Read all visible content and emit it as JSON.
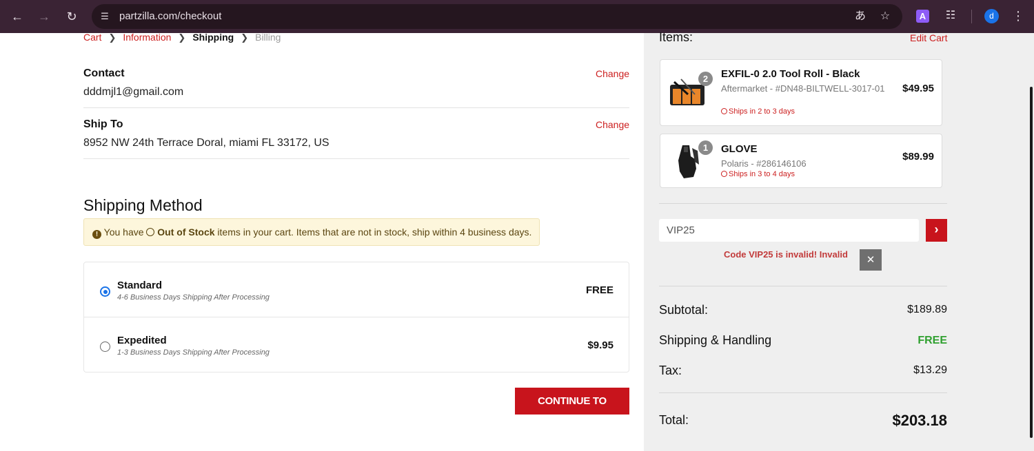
{
  "browser": {
    "url": "partzilla.com/checkout",
    "profile_initial": "d",
    "extension_letter": "A"
  },
  "breadcrumb": {
    "items": [
      "Cart",
      "Information",
      "Shipping",
      "Billing"
    ],
    "current": "Shipping"
  },
  "contact": {
    "label": "Contact",
    "value": "dddmjl1@gmail.com",
    "change": "Change"
  },
  "ship_to": {
    "label": "Ship To",
    "value": "8952 NW 24th Terrace Doral, miami FL 33172, US",
    "change": "Change"
  },
  "shipping_method": {
    "title": "Shipping Method",
    "notice": {
      "prefix": "You have",
      "strong": "Out of Stock",
      "suffix": "items in your cart. Items that are not in stock, ship within 4 business days."
    },
    "options": [
      {
        "name": "Standard",
        "description": "4-6 Business Days Shipping After Processing",
        "price": "FREE",
        "selected": true
      },
      {
        "name": "Expedited",
        "description": "1-3 Business Days Shipping After Processing",
        "price": "$9.95",
        "selected": false
      }
    ],
    "continue_label": "CONTINUE TO PAYMENT"
  },
  "summary": {
    "items_title": "Items:",
    "edit_cart": "Edit Cart",
    "items": [
      {
        "name": "EXFIL-0 2.0 Tool Roll - Black",
        "sku": "Aftermarket - #DN48-BILTWELL-3017-01",
        "ship": "Ships in 2 to 3 days",
        "price": "$49.95",
        "qty": "2"
      },
      {
        "name": "GLOVE",
        "sku": "Polaris - #286146106",
        "ship": "Ships in 3 to 4 days",
        "price": "$89.99",
        "qty": "1"
      }
    ],
    "coupon": {
      "value": "VIP25",
      "error": "Code VIP25 is invalid! Invalid"
    },
    "subtotal_label": "Subtotal:",
    "subtotal": "$189.89",
    "shipping_label": "Shipping & Handling",
    "shipping": "FREE",
    "tax_label": "Tax:",
    "tax": "$13.29",
    "total_label": "Total:",
    "total": "$203.18"
  },
  "colors": {
    "brand_red": "#c8141c",
    "link_red": "#cc1f1f",
    "free_green": "#2fa02f",
    "radio_blue": "#1a73e8"
  }
}
